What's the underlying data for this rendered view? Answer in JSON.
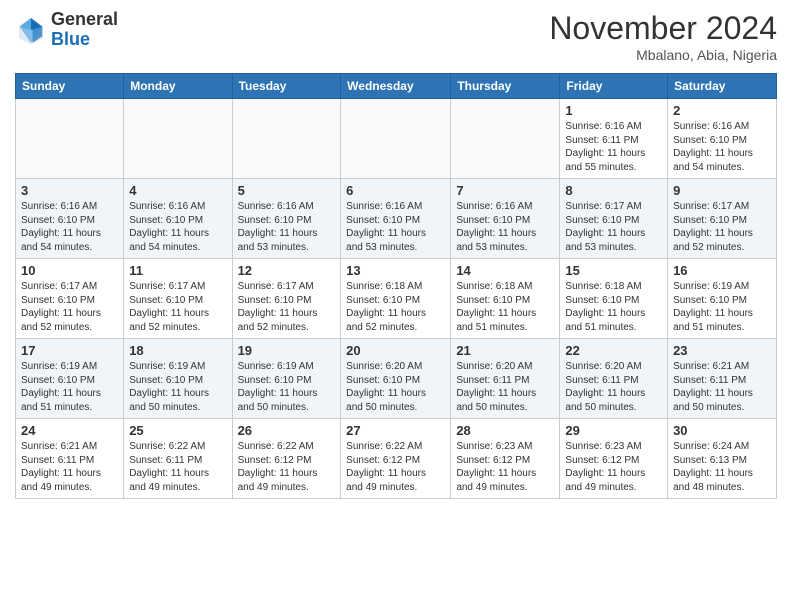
{
  "header": {
    "logo_general": "General",
    "logo_blue": "Blue",
    "month_title": "November 2024",
    "location": "Mbalano, Abia, Nigeria"
  },
  "days_of_week": [
    "Sunday",
    "Monday",
    "Tuesday",
    "Wednesday",
    "Thursday",
    "Friday",
    "Saturday"
  ],
  "weeks": [
    [
      {
        "num": "",
        "info": ""
      },
      {
        "num": "",
        "info": ""
      },
      {
        "num": "",
        "info": ""
      },
      {
        "num": "",
        "info": ""
      },
      {
        "num": "",
        "info": ""
      },
      {
        "num": "1",
        "info": "Sunrise: 6:16 AM\nSunset: 6:11 PM\nDaylight: 11 hours\nand 55 minutes."
      },
      {
        "num": "2",
        "info": "Sunrise: 6:16 AM\nSunset: 6:10 PM\nDaylight: 11 hours\nand 54 minutes."
      }
    ],
    [
      {
        "num": "3",
        "info": "Sunrise: 6:16 AM\nSunset: 6:10 PM\nDaylight: 11 hours\nand 54 minutes."
      },
      {
        "num": "4",
        "info": "Sunrise: 6:16 AM\nSunset: 6:10 PM\nDaylight: 11 hours\nand 54 minutes."
      },
      {
        "num": "5",
        "info": "Sunrise: 6:16 AM\nSunset: 6:10 PM\nDaylight: 11 hours\nand 53 minutes."
      },
      {
        "num": "6",
        "info": "Sunrise: 6:16 AM\nSunset: 6:10 PM\nDaylight: 11 hours\nand 53 minutes."
      },
      {
        "num": "7",
        "info": "Sunrise: 6:16 AM\nSunset: 6:10 PM\nDaylight: 11 hours\nand 53 minutes."
      },
      {
        "num": "8",
        "info": "Sunrise: 6:17 AM\nSunset: 6:10 PM\nDaylight: 11 hours\nand 53 minutes."
      },
      {
        "num": "9",
        "info": "Sunrise: 6:17 AM\nSunset: 6:10 PM\nDaylight: 11 hours\nand 52 minutes."
      }
    ],
    [
      {
        "num": "10",
        "info": "Sunrise: 6:17 AM\nSunset: 6:10 PM\nDaylight: 11 hours\nand 52 minutes."
      },
      {
        "num": "11",
        "info": "Sunrise: 6:17 AM\nSunset: 6:10 PM\nDaylight: 11 hours\nand 52 minutes."
      },
      {
        "num": "12",
        "info": "Sunrise: 6:17 AM\nSunset: 6:10 PM\nDaylight: 11 hours\nand 52 minutes."
      },
      {
        "num": "13",
        "info": "Sunrise: 6:18 AM\nSunset: 6:10 PM\nDaylight: 11 hours\nand 52 minutes."
      },
      {
        "num": "14",
        "info": "Sunrise: 6:18 AM\nSunset: 6:10 PM\nDaylight: 11 hours\nand 51 minutes."
      },
      {
        "num": "15",
        "info": "Sunrise: 6:18 AM\nSunset: 6:10 PM\nDaylight: 11 hours\nand 51 minutes."
      },
      {
        "num": "16",
        "info": "Sunrise: 6:19 AM\nSunset: 6:10 PM\nDaylight: 11 hours\nand 51 minutes."
      }
    ],
    [
      {
        "num": "17",
        "info": "Sunrise: 6:19 AM\nSunset: 6:10 PM\nDaylight: 11 hours\nand 51 minutes."
      },
      {
        "num": "18",
        "info": "Sunrise: 6:19 AM\nSunset: 6:10 PM\nDaylight: 11 hours\nand 50 minutes."
      },
      {
        "num": "19",
        "info": "Sunrise: 6:19 AM\nSunset: 6:10 PM\nDaylight: 11 hours\nand 50 minutes."
      },
      {
        "num": "20",
        "info": "Sunrise: 6:20 AM\nSunset: 6:10 PM\nDaylight: 11 hours\nand 50 minutes."
      },
      {
        "num": "21",
        "info": "Sunrise: 6:20 AM\nSunset: 6:11 PM\nDaylight: 11 hours\nand 50 minutes."
      },
      {
        "num": "22",
        "info": "Sunrise: 6:20 AM\nSunset: 6:11 PM\nDaylight: 11 hours\nand 50 minutes."
      },
      {
        "num": "23",
        "info": "Sunrise: 6:21 AM\nSunset: 6:11 PM\nDaylight: 11 hours\nand 50 minutes."
      }
    ],
    [
      {
        "num": "24",
        "info": "Sunrise: 6:21 AM\nSunset: 6:11 PM\nDaylight: 11 hours\nand 49 minutes."
      },
      {
        "num": "25",
        "info": "Sunrise: 6:22 AM\nSunset: 6:11 PM\nDaylight: 11 hours\nand 49 minutes."
      },
      {
        "num": "26",
        "info": "Sunrise: 6:22 AM\nSunset: 6:12 PM\nDaylight: 11 hours\nand 49 minutes."
      },
      {
        "num": "27",
        "info": "Sunrise: 6:22 AM\nSunset: 6:12 PM\nDaylight: 11 hours\nand 49 minutes."
      },
      {
        "num": "28",
        "info": "Sunrise: 6:23 AM\nSunset: 6:12 PM\nDaylight: 11 hours\nand 49 minutes."
      },
      {
        "num": "29",
        "info": "Sunrise: 6:23 AM\nSunset: 6:12 PM\nDaylight: 11 hours\nand 49 minutes."
      },
      {
        "num": "30",
        "info": "Sunrise: 6:24 AM\nSunset: 6:13 PM\nDaylight: 11 hours\nand 48 minutes."
      }
    ]
  ]
}
